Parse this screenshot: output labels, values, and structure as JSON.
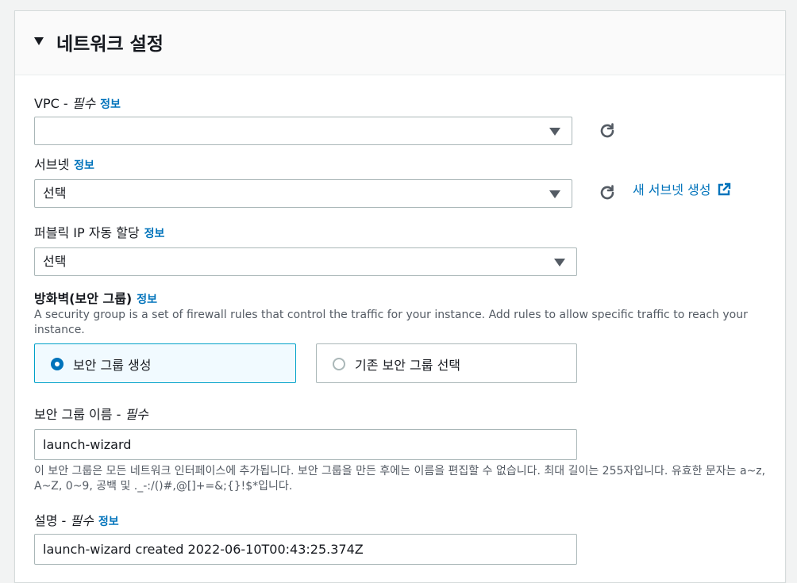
{
  "section": {
    "title": "네트워크 설정"
  },
  "vpc": {
    "label": "VPC - ",
    "required": "필수",
    "info": "정보",
    "value": ""
  },
  "subnet": {
    "label": "서브넷",
    "info": "정보",
    "value": "선택",
    "create_link": "새 서브넷 생성"
  },
  "public_ip": {
    "label": "퍼블릭 IP 자동 할당",
    "info": "정보",
    "value": "선택"
  },
  "firewall": {
    "label": "방화벽(보안 그룹)",
    "info": "정보",
    "description": "A security group is a set of firewall rules that control the traffic for your instance. Add rules to allow specific traffic to reach your instance.",
    "options": [
      {
        "label": "보안 그룹 생성",
        "selected": true
      },
      {
        "label": "기존 보안 그룹 선택",
        "selected": false
      }
    ]
  },
  "sg_name": {
    "label": "보안 그룹 이름 - ",
    "required": "필수",
    "value": "launch-wizard",
    "hint": "이 보안 그룹은 모든 네트워크 인터페이스에 추가됩니다. 보안 그룹을 만든 후에는 이름을 편집할 수 없습니다. 최대 길이는 255자입니다. 유효한 문자는 a~z, A~Z, 0~9, 공백 및 ._-:/()#,@[]+=&;{}!$*입니다."
  },
  "sg_desc": {
    "label": "설명 - ",
    "required": "필수",
    "info": "정보",
    "value": "launch-wizard created 2022-06-10T00:43:25.374Z"
  },
  "colors": {
    "link": "#0073bb",
    "selected_border": "#00a1c9",
    "selected_bg": "#f1faff"
  },
  "icons": [
    "caret-down-icon",
    "dropdown-arrow-icon",
    "refresh-icon",
    "external-link-icon",
    "radio-icon"
  ]
}
